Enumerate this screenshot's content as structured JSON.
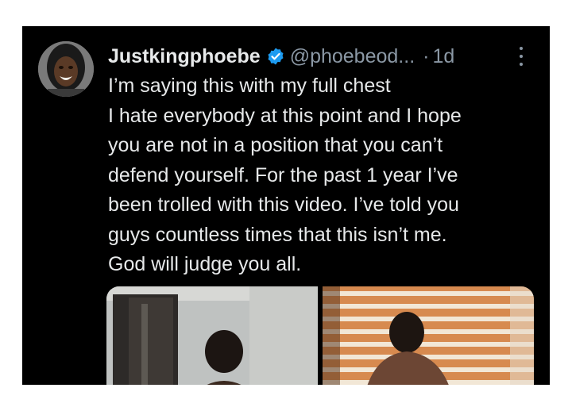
{
  "tweet": {
    "author_name": "Justkingphoebe",
    "handle": "@phoebeod...",
    "separator": "·",
    "time": "1d",
    "verified": true,
    "lines": [
      "I’m saying this with my full chest",
      "I hate everybody at this point and I hope",
      "you are not in a position that you can’t",
      "defend yourself. For the past 1 year I’ve",
      "been trolled with this video. I’ve told you",
      "guys countless times that this isn’t me.",
      "God will judge you all."
    ]
  },
  "icons": {
    "verified": "verified-badge-icon",
    "more": "more-options-icon"
  },
  "colors": {
    "background": "#000000",
    "text": "#e7e9ea",
    "muted": "#8b98a5",
    "verified": "#1d9bf0"
  }
}
